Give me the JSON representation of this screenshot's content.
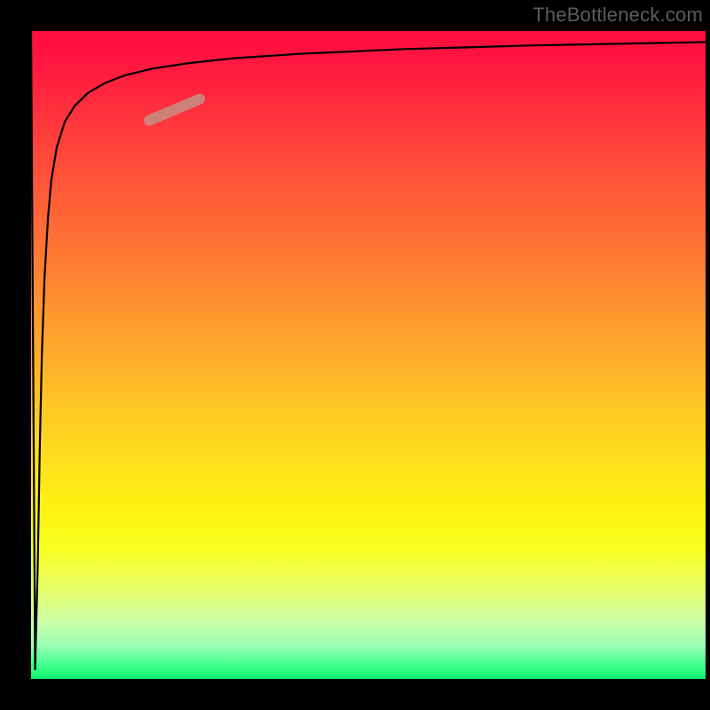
{
  "attribution": "TheBottleneck.com",
  "colors": {
    "frame": "#000000",
    "curve": "#000000",
    "marker": "#c98b80",
    "gradient_top": "#ff0b40",
    "gradient_mid": "#ffdc1e",
    "gradient_bottom": "#10f26d"
  },
  "chart_data": {
    "type": "line",
    "title": "",
    "xlabel": "",
    "ylabel": "",
    "xlim": [
      0,
      100
    ],
    "ylim": [
      0,
      100
    ],
    "series": [
      {
        "name": "curve",
        "x": [
          0,
          0.6,
          1.0,
          1.3,
          1.6,
          2.0,
          2.5,
          3.0,
          3.8,
          5.0,
          6.5,
          8.5,
          11,
          14,
          18,
          23,
          30,
          40,
          55,
          75,
          100
        ],
        "y": [
          100,
          1.5,
          18,
          36,
          50,
          62,
          71,
          77,
          82,
          86,
          88.5,
          90.5,
          92,
          93.2,
          94.2,
          95,
          95.8,
          96.5,
          97.2,
          97.8,
          98.3
        ]
      },
      {
        "name": "marker-segment",
        "x": [
          17.5,
          25
        ],
        "y": [
          86.2,
          89.5
        ]
      }
    ]
  }
}
